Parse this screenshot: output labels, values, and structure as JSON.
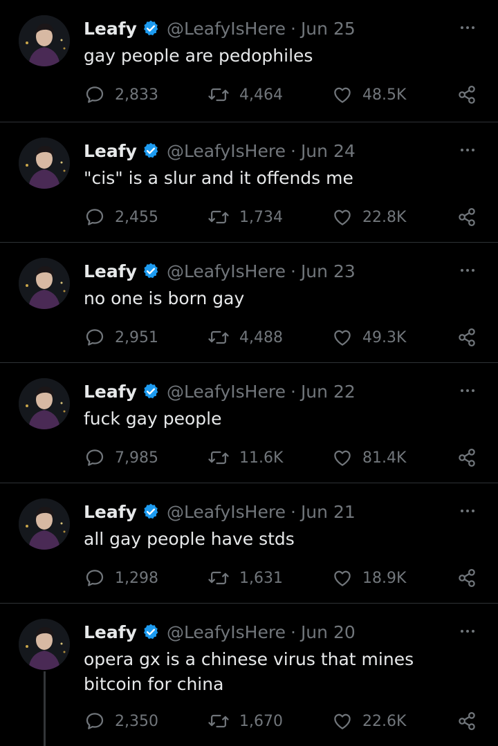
{
  "colors": {
    "background": "#000000",
    "text": "#e7e9ea",
    "secondary": "#71767b",
    "divider": "#2f3336",
    "verified": "#1d9bf0"
  },
  "icons": {
    "verified": "verified-badge-icon",
    "more": "more-dots-icon",
    "reply": "reply-icon",
    "retweet": "retweet-icon",
    "like": "heart-icon",
    "share": "share-icon"
  },
  "tweets": [
    {
      "name": "Leafy",
      "handle": "@LeafyIsHere",
      "separator": "·",
      "date": "Jun 25",
      "text": "gay people are pedophiles",
      "replies": "2,833",
      "retweets": "4,464",
      "likes": "48.5K"
    },
    {
      "name": "Leafy",
      "handle": "@LeafyIsHere",
      "separator": "·",
      "date": "Jun 24",
      "text": "\"cis\" is a slur and it offends me",
      "replies": "2,455",
      "retweets": "1,734",
      "likes": "22.8K"
    },
    {
      "name": "Leafy",
      "handle": "@LeafyIsHere",
      "separator": "·",
      "date": "Jun 23",
      "text": "no one is born gay",
      "replies": "2,951",
      "retweets": "4,488",
      "likes": "49.3K"
    },
    {
      "name": "Leafy",
      "handle": "@LeafyIsHere",
      "separator": "·",
      "date": "Jun 22",
      "text": "fuck gay people",
      "replies": "7,985",
      "retweets": "11.6K",
      "likes": "81.4K"
    },
    {
      "name": "Leafy",
      "handle": "@LeafyIsHere",
      "separator": "·",
      "date": "Jun 21",
      "text": "all gay people have stds",
      "replies": "1,298",
      "retweets": "1,631",
      "likes": "18.9K"
    },
    {
      "name": "Leafy",
      "handle": "@LeafyIsHere",
      "separator": "·",
      "date": "Jun 20",
      "text": "opera gx is a chinese virus that mines bitcoin for china",
      "replies": "2,350",
      "retweets": "1,670",
      "likes": "22.6K"
    }
  ]
}
